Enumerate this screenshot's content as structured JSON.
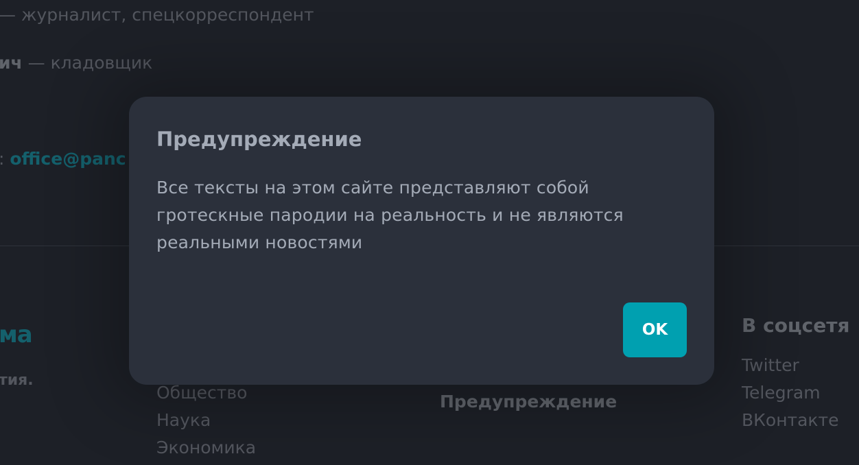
{
  "staff": {
    "line1_role": "— журналист, спецкорреспондент",
    "line2_name_fragment": "ич",
    "line2_role": " — кладовщик",
    "line3_prefix": ": ",
    "line3_email_fragment": "office@panc"
  },
  "footer": {
    "logo_fragment": "ма",
    "tagline_fragment": "тия.",
    "sections": [
      "Общество",
      "Наука",
      "Экономика"
    ],
    "warning_link": "Предупреждение",
    "social_heading": "В соцсетя",
    "social_links": [
      "Twitter",
      "Telegram",
      "ВКонтакте"
    ]
  },
  "modal": {
    "title": "Предупреждение",
    "body": "Все тексты на этом сайте представляют собой гротескные пародии на реальность и не являются реальными новостями",
    "ok_label": "OK"
  },
  "colors": {
    "accent": "#00a0b0",
    "background": "#2a2e37",
    "modal_background": "#2b303b",
    "muted_text": "#8c919b"
  }
}
